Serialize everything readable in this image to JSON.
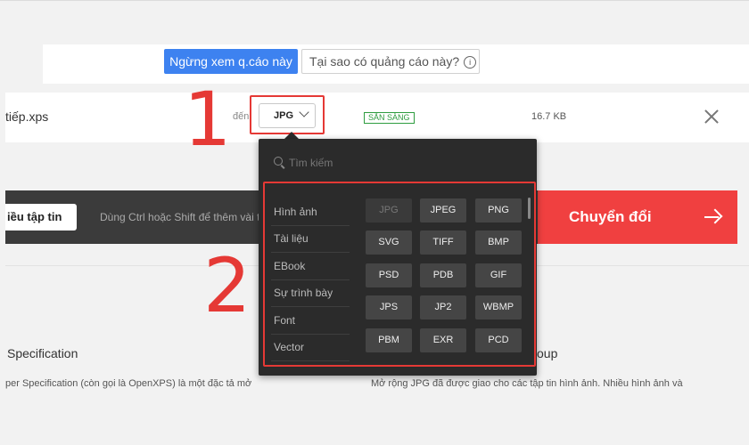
{
  "ad": {
    "stop_label": "Ngừng xem q.cáo này",
    "why_label": "Tại sao có quảng cáo này?",
    "why_icon": "i"
  },
  "file": {
    "name": "tiếp.xps",
    "to_label": "đến",
    "format_value": "JPG",
    "status": "SẴN SÀNG",
    "size": "16.7 KB"
  },
  "annotations": {
    "step1": "1",
    "step2": "2"
  },
  "action": {
    "add_label": "iều tập tin",
    "hint": "Dùng Ctrl hoặc Shift để thêm vài tệp",
    "convert_label": "Chuyển đổi"
  },
  "dropdown": {
    "search_placeholder": "Tìm kiếm",
    "categories": [
      "Hình ảnh",
      "Tài liệu",
      "EBook",
      "Sự trình bày",
      "Font",
      "Vector"
    ],
    "formats": [
      "JPG",
      "JPEG",
      "PNG",
      "SVG",
      "TIFF",
      "BMP",
      "PSD",
      "PDB",
      "GIF",
      "JPS",
      "JP2",
      "WBMP",
      "PBM",
      "EXR",
      "PCD"
    ],
    "disabled_format": "JPG"
  },
  "info": {
    "left_title": "Specification",
    "left_desc": "per Specification (còn gọi là OpenXPS) là một đặc tả mở",
    "right_title": "oup",
    "right_desc": "Mở rộng JPG đã được giao cho các tập tin hình ảnh. Nhiều hình ảnh và"
  },
  "colors": {
    "accent_blue": "#3d82f0",
    "convert_red": "#f04040",
    "annotation_red": "#e53935",
    "status_green": "#2e9c3f",
    "dropdown_bg": "#2b2b2b"
  }
}
